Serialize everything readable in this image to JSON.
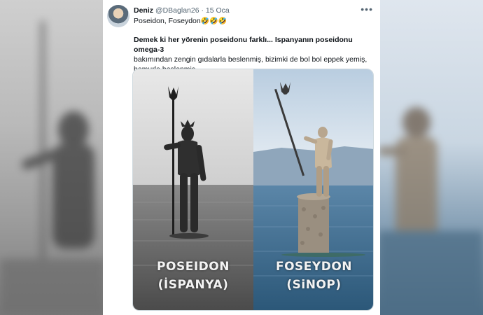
{
  "tweet": {
    "display_name": "Deniz",
    "handle": "@DBaglan26",
    "separator": "·",
    "date": "15 Oca",
    "more_icon": "more-icon",
    "first_line": "Poseidon, Foseydon",
    "first_line_emoji": "🤣🤣🤣",
    "body_bold": "Demek ki her yörenin poseidonu farklı... Ispanyanın poseidonu omega-3",
    "body_regular": "bakımından zengin gıdalarla beslenmiş, bizimki de bol bol eppek yemiş, hamurla beslenmiş...."
  },
  "media": {
    "left": {
      "title": "POSEIDON",
      "subtitle": "(İSPANYA)"
    },
    "right": {
      "title": "FOSEYDON",
      "subtitle": "(SiNOP)"
    }
  },
  "colors": {
    "card_bg": "#ffffff",
    "text_primary": "#0f1419",
    "text_secondary": "#536471",
    "sea_right": "#3f6f96",
    "sea_left": "#6c6c6c"
  }
}
